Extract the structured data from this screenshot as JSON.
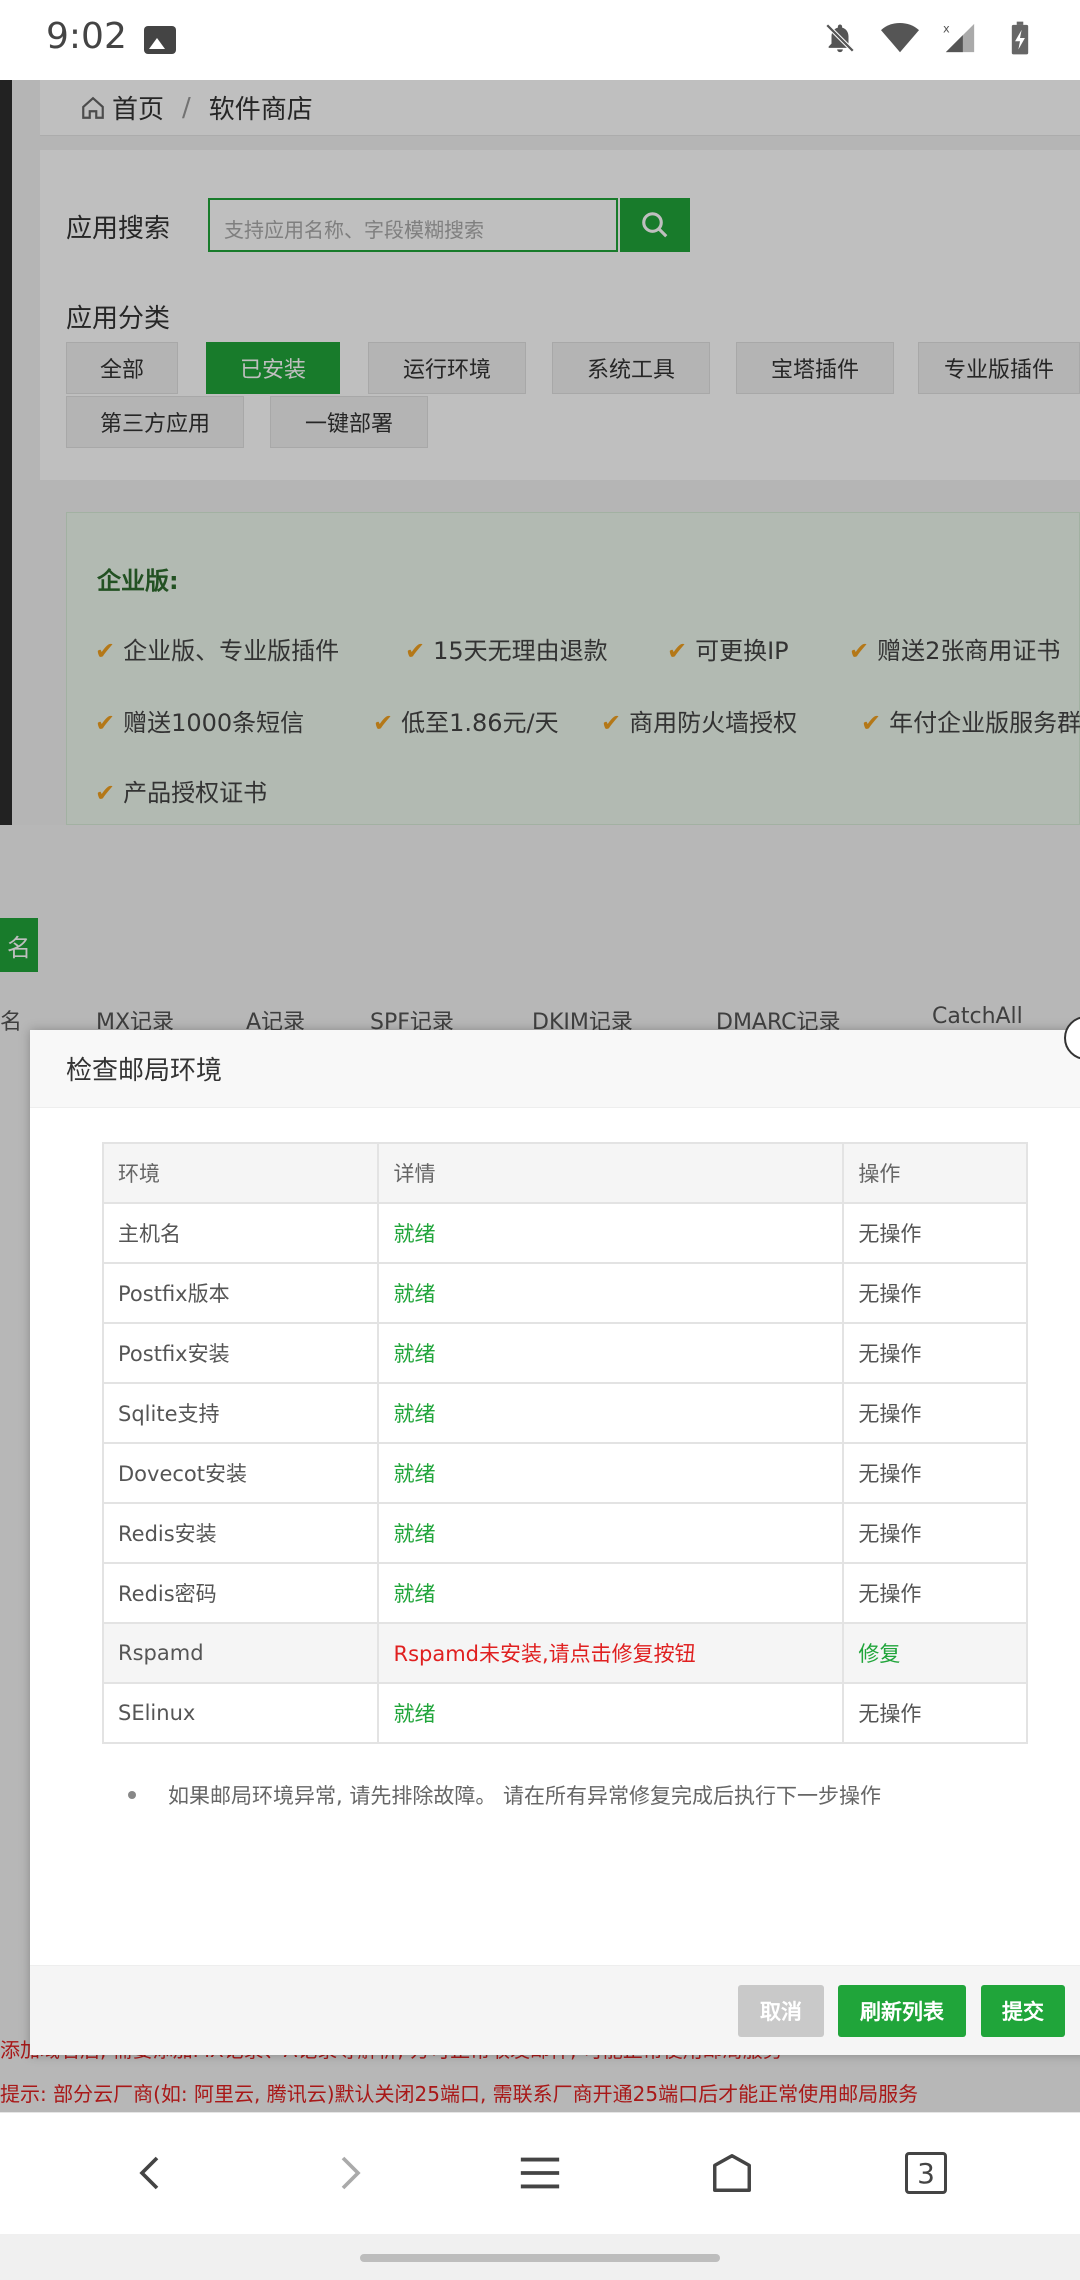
{
  "status_bar": {
    "time": "9:02"
  },
  "breadcrumb": {
    "home": "首页",
    "separator": "/",
    "current": "软件商店"
  },
  "search": {
    "label": "应用搜索",
    "placeholder": "支持应用名称、字段模糊搜索"
  },
  "category": {
    "label": "应用分类",
    "items": [
      "全部",
      "已安装",
      "运行环境",
      "系统工具",
      "宝塔插件",
      "专业版插件",
      "第三方应用",
      "一键部署"
    ],
    "active": "已安装"
  },
  "enterprise": {
    "title": "企业版:",
    "features": [
      "企业版、专业版插件",
      "15天无理由退款",
      "可更换IP",
      "赠送2张商用证书",
      "赠送1000条短信",
      "低至1.86元/天",
      "商用防火墙授权",
      "年付企业版服务群",
      "产品授权证书"
    ]
  },
  "mail_page": {
    "add_button": "名",
    "tabs": [
      "名",
      "MX记录",
      "A记录",
      "SPF记录",
      "DKIM记录",
      "DMARC记录",
      "CatchAll"
    ],
    "notice1": "添加域名后, 需要添加MX记录、A记录等解析, 方可正常收发邮件, 可能正常使用邮局服务",
    "notice2": "提示: 部分云厂商(如: 阿里云, 腾讯云)默认关闭25端口, 需联系厂商开通25端口后才能正常使用邮局服务"
  },
  "modal": {
    "title": "检查邮局环境",
    "columns": [
      "环境",
      "详情",
      "操作"
    ],
    "rows": [
      {
        "env": "主机名",
        "detail": "就绪",
        "action": "无操作"
      },
      {
        "env": "Postfix版本",
        "detail": "就绪",
        "action": "无操作"
      },
      {
        "env": "Postfix安装",
        "detail": "就绪",
        "action": "无操作"
      },
      {
        "env": "Sqlite支持",
        "detail": "就绪",
        "action": "无操作"
      },
      {
        "env": "Dovecot安装",
        "detail": "就绪",
        "action": "无操作"
      },
      {
        "env": "Redis安装",
        "detail": "就绪",
        "action": "无操作"
      },
      {
        "env": "Redis密码",
        "detail": "就绪",
        "action": "无操作"
      },
      {
        "env": "Rspamd",
        "detail": "Rspamd未安装,请点击修复按钮",
        "action": "修复"
      },
      {
        "env": "SElinux",
        "detail": "就绪",
        "action": "无操作"
      }
    ],
    "tip": "如果邮局环境异常, 请先排除故障。 请在所有异常修复完成后执行下一步操作",
    "buttons": {
      "cancel": "取消",
      "refresh": "刷新列表",
      "submit": "提交"
    }
  },
  "browser": {
    "tab_count": "3"
  },
  "colors": {
    "primary_green": "#20a53a",
    "error_red": "#e02020",
    "check_orange": "#f0a020"
  }
}
